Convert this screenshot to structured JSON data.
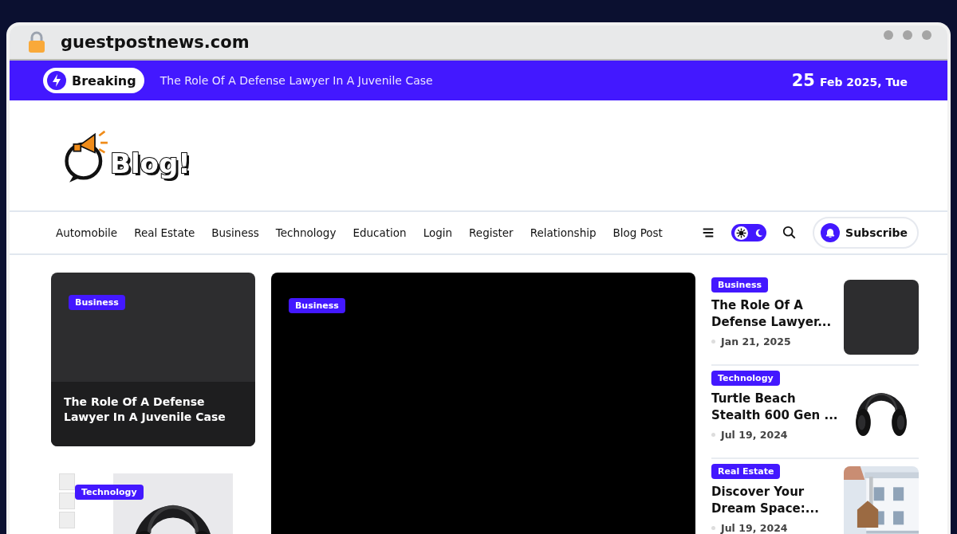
{
  "browser": {
    "url": "guestpostnews.com"
  },
  "breaking": {
    "label": "Breaking",
    "headline": "The Role Of A Defense Lawyer In A Juvenile Case",
    "date_day": "25",
    "date_rest": "Feb 2025, Tue"
  },
  "logo": {
    "text": "Blog!"
  },
  "nav": {
    "items": [
      "Automobile",
      "Real Estate",
      "Business",
      "Technology",
      "Education",
      "Login",
      "Register",
      "Relationship",
      "Blog Post"
    ],
    "dark_mode": false,
    "subscribe": "Subscribe"
  },
  "left_column": {
    "feature": {
      "category": "Business",
      "title": "The Role Of A Defense Lawyer In A Juvenile Case"
    },
    "second": {
      "category": "Technology",
      "kind": "picture"
    }
  },
  "center": {
    "category": "Business"
  },
  "sidebar": [
    {
      "category": "Business",
      "title": "The Role Of A Defense Lawyer...",
      "date": "Jan 21, 2025",
      "kind": "panel"
    },
    {
      "category": "Technology",
      "title": "Turtle Beach Stealth 600 Gen ...",
      "date": "Jul 19, 2024",
      "kind": "picture"
    },
    {
      "category": "Real Estate",
      "title": "Discover Your Dream Space:...",
      "date": "Jul 19, 2024",
      "kind": "picture"
    }
  ]
}
